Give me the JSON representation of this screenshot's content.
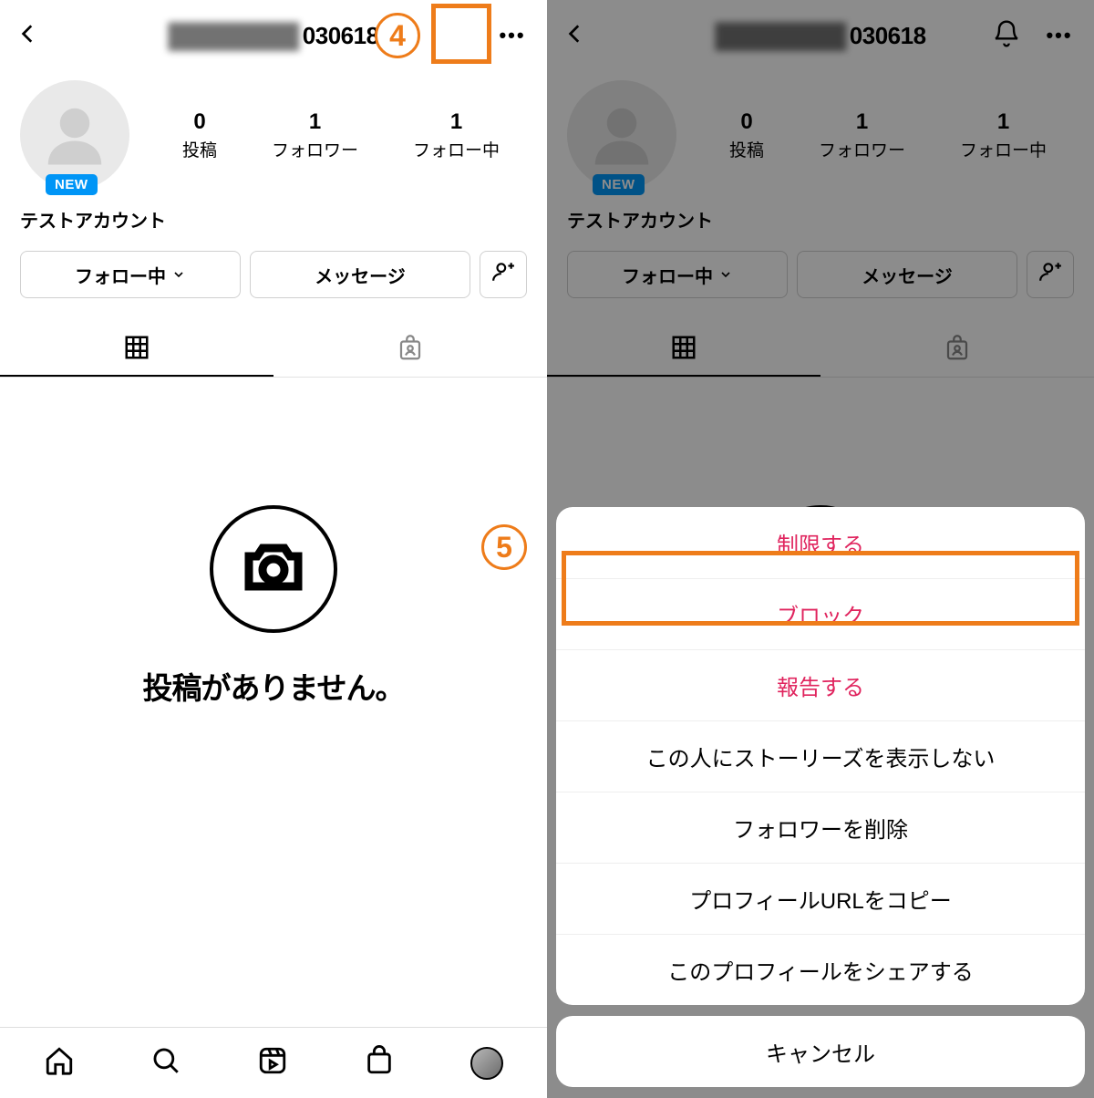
{
  "header": {
    "username_blurred": "████████",
    "username_clear": "030618"
  },
  "profile": {
    "new_badge": "NEW",
    "display_name": "テストアカウント",
    "stats": {
      "posts": {
        "num": "0",
        "label": "投稿"
      },
      "followers": {
        "num": "1",
        "label": "フォロワー"
      },
      "following": {
        "num": "1",
        "label": "フォロー中"
      }
    }
  },
  "buttons": {
    "following": "フォロー中",
    "message": "メッセージ"
  },
  "empty": {
    "text": "投稿がありません。"
  },
  "sheet": {
    "restrict": "制限する",
    "block": "ブロック",
    "report": "報告する",
    "hide_story": "この人にストーリーズを表示しない",
    "remove_follower": "フォロワーを削除",
    "copy_url": "プロフィールURLをコピー",
    "share_profile": "このプロフィールをシェアする",
    "cancel": "キャンセル"
  },
  "steps": {
    "s4": "4",
    "s5": "5"
  }
}
